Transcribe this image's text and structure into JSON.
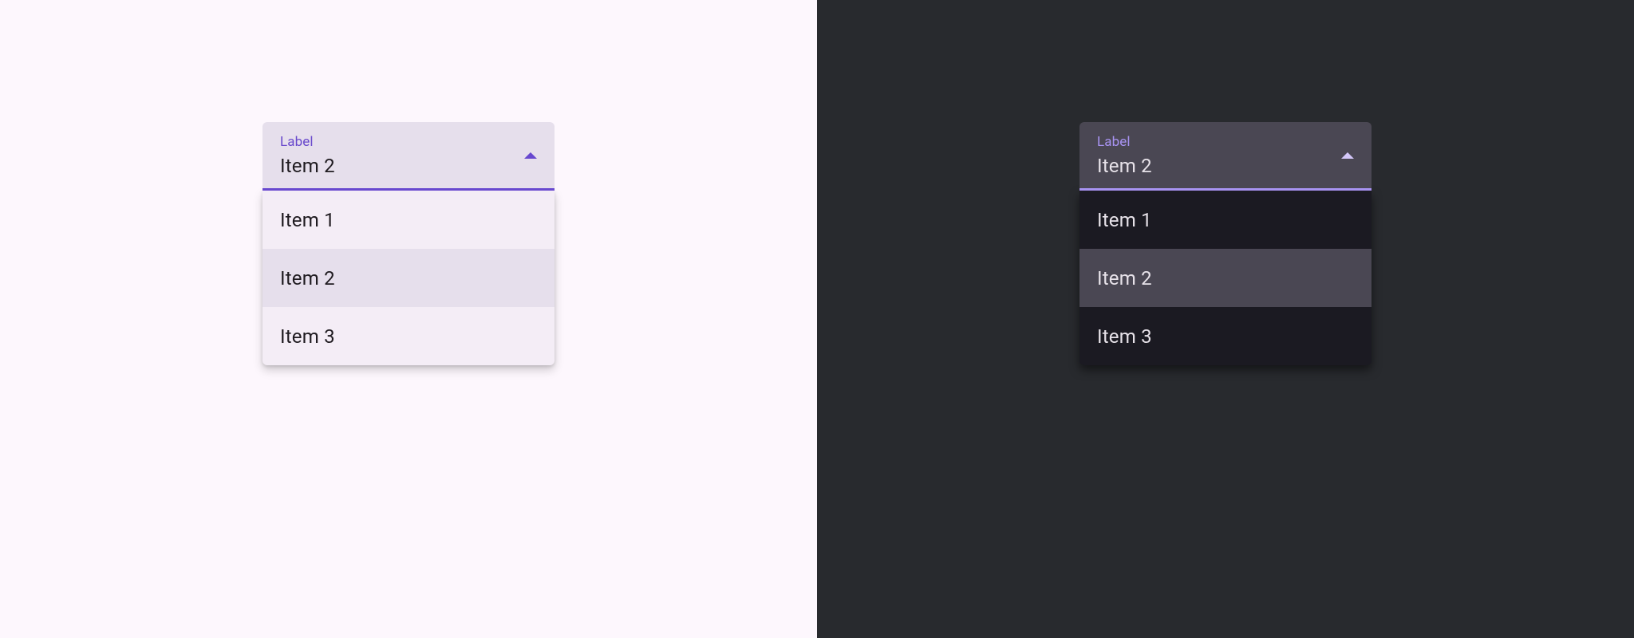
{
  "colors": {
    "light_bg": "#fdf7fd",
    "dark_bg": "#282a2e",
    "light_header_bg": "#e6dfec",
    "dark_header_bg": "#4a4753",
    "light_accent": "#6848cf",
    "dark_accent": "#a893f2",
    "light_menu_bg": "#f4edf6",
    "dark_menu_bg": "#1b1a22",
    "light_selected_bg": "#e6dfec",
    "dark_selected_bg": "#4a4753",
    "light_text": "#1f1b20",
    "dark_text": "#e7e2e9"
  },
  "light": {
    "label": "Label",
    "value": "Item 2",
    "expanded": true,
    "options": [
      "Item 1",
      "Item 2",
      "Item 3"
    ],
    "selected_index": 1
  },
  "dark": {
    "label": "Label",
    "value": "Item 2",
    "expanded": true,
    "options": [
      "Item 1",
      "Item 2",
      "Item 3"
    ],
    "selected_index": 1
  }
}
